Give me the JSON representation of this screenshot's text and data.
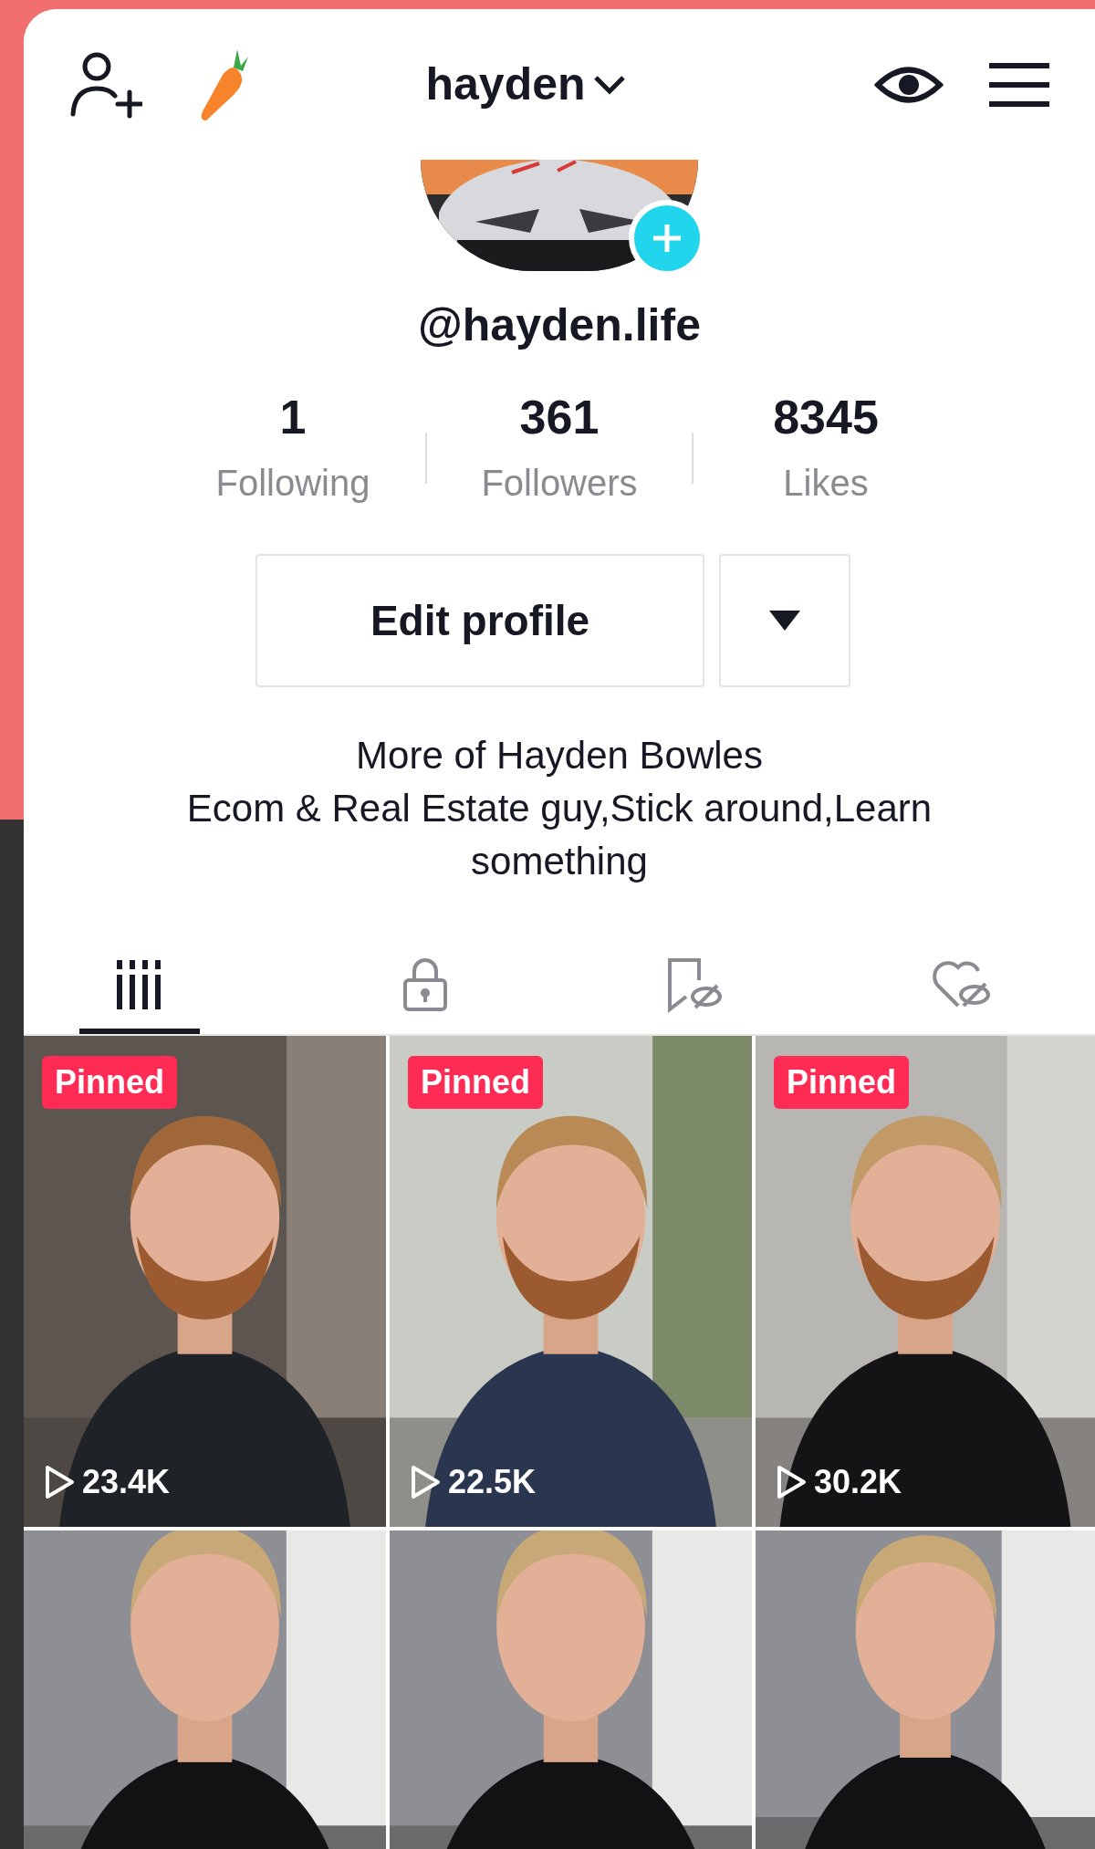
{
  "header": {
    "title": "hayden"
  },
  "profile": {
    "handle": "@hayden.life",
    "stats": [
      {
        "value": "1",
        "label": "Following"
      },
      {
        "value": "361",
        "label": "Followers"
      },
      {
        "value": "8345",
        "label": "Likes"
      }
    ],
    "edit_button": "Edit profile",
    "bio": [
      "More of Hayden Bowles",
      "Ecom & Real Estate guy,Stick around,Learn something"
    ]
  },
  "tabs": [
    {
      "kind": "videos",
      "selected": true
    },
    {
      "kind": "private",
      "selected": false
    },
    {
      "kind": "saved",
      "selected": false
    },
    {
      "kind": "liked",
      "selected": false
    }
  ],
  "videos": [
    {
      "kind": "picture",
      "badge": "Pinned",
      "views": "23.4K"
    },
    {
      "kind": "picture",
      "badge": "Pinned",
      "views": "22.5K"
    },
    {
      "kind": "picture",
      "badge": "Pinned",
      "views": "30.2K"
    },
    {
      "kind": "picture"
    },
    {
      "kind": "picture"
    },
    {
      "kind": "picture"
    }
  ]
}
